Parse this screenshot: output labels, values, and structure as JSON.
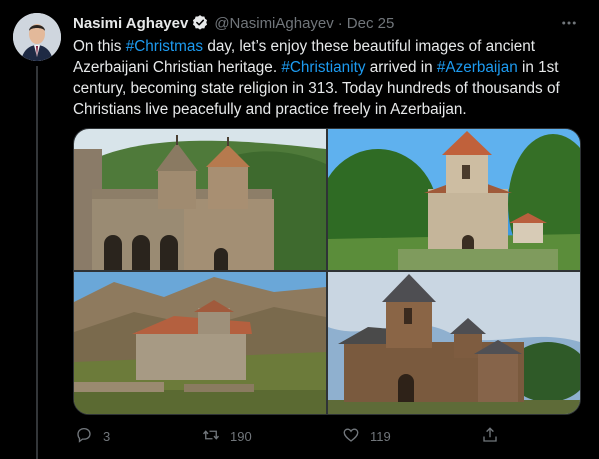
{
  "tweet": {
    "author_name": "Nasimi Aghayev",
    "author_handle": "@NasimiAghayev",
    "separator": "·",
    "timestamp": "Dec 25",
    "text": {
      "s1": "On this ",
      "h1": "#Christmas",
      "s2": " day, let’s enjoy these beautiful images of ancient Azerbaijani Christian heritage. ",
      "h2": "#Christianity",
      "s3": " arrived in ",
      "h3": "#Azerbaijan",
      "s4": " in 1st century, becoming state religion in 313. Today hundreds of thousands of Christians live peacefully and practice freely in Azerbaijan."
    },
    "reply_count": "3",
    "retweet_count": "190",
    "like_count": "119"
  },
  "icons": {
    "verified": "verified-badge-icon",
    "more": "more-horizontal-icon",
    "reply": "reply-icon",
    "retweet": "retweet-icon",
    "like": "heart-icon",
    "share": "share-icon"
  },
  "colors": {
    "background": "#000000",
    "text_primary": "#e7e9ea",
    "text_secondary": "#71767b",
    "accent": "#1d9bf0"
  }
}
